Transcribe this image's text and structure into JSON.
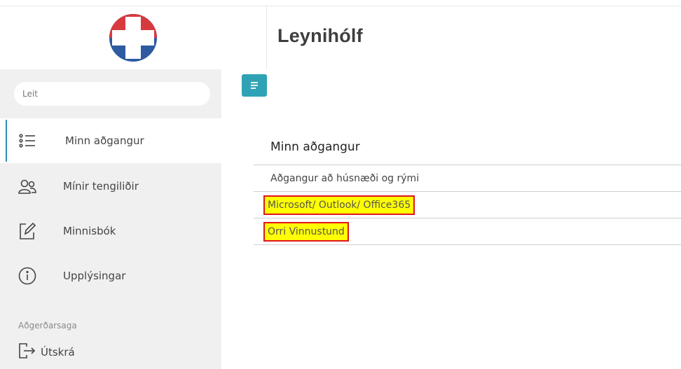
{
  "header": {
    "title": "Leynihólf",
    "logo": "red-cross-logo"
  },
  "sidebar": {
    "search": {
      "placeholder": "Leit",
      "value": ""
    },
    "items": [
      {
        "label": "Minn aðgangur",
        "icon": "list-icon",
        "active": true
      },
      {
        "label": "Mínir tengiliðir",
        "icon": "contacts-icon",
        "active": false
      },
      {
        "label": "Minnisbók",
        "icon": "notebook-icon",
        "active": false
      },
      {
        "label": "Upplýsingar",
        "icon": "info-icon",
        "active": false
      }
    ],
    "section_label": "Aðgerðarsaga",
    "logout_label": "Útskrá"
  },
  "main": {
    "menu_toggle_icon": "menu-icon",
    "title": "Minn aðgangur",
    "rows": [
      {
        "label": "Aðgangur að húsnæði og rými",
        "highlighted": false
      },
      {
        "label": "Microsoft/ Outlook/ Office365",
        "highlighted": true
      },
      {
        "label": "Orri Vinnustund",
        "highlighted": true
      }
    ]
  },
  "colors": {
    "accent": "#2fa3b5",
    "logo_red": "#d63a3f",
    "logo_blue": "#2d5aa0",
    "highlight": "#ffff00",
    "highlight_border": "#e0141e"
  }
}
